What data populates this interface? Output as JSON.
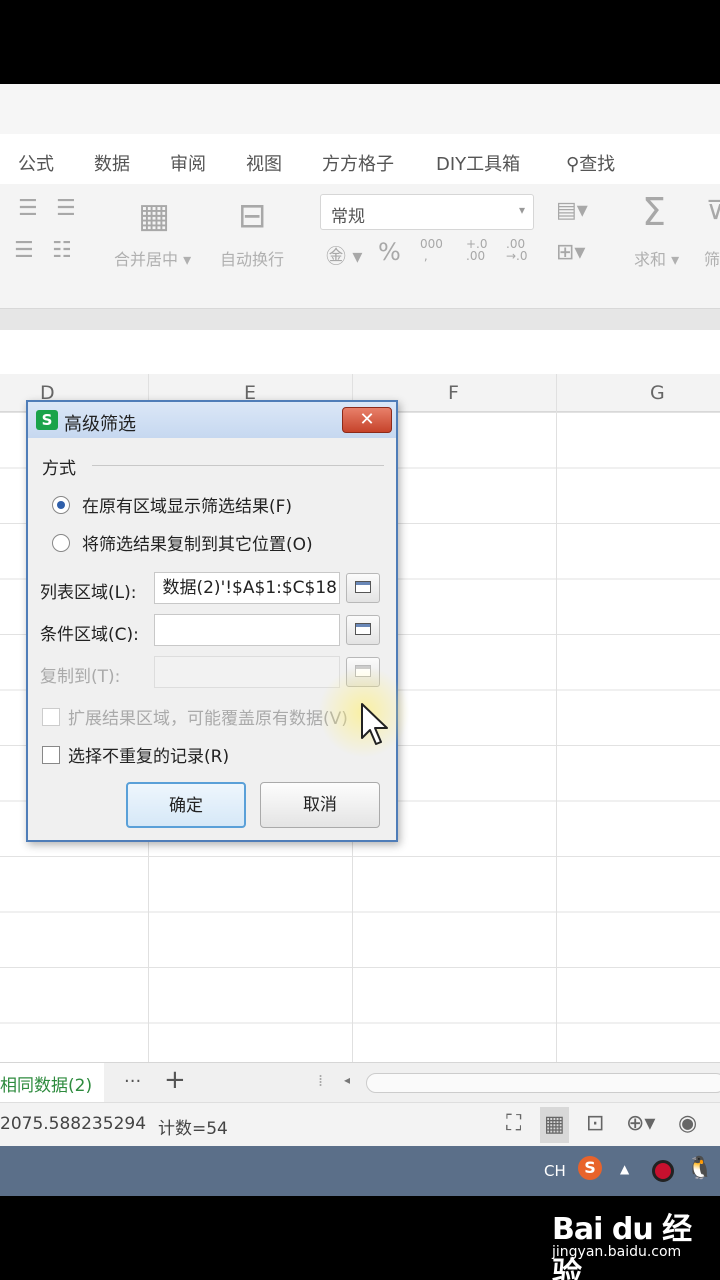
{
  "ribbon": {
    "tabs": [
      "公式",
      "数据",
      "审阅",
      "视图",
      "方方格子",
      "DIY工具箱",
      "查找"
    ],
    "merge_label": "合并居中",
    "wrap_label": "自动换行",
    "number_format": "常规",
    "percent_symbol": "%",
    "sum_label": "求和",
    "filter_partial": "筛"
  },
  "columns": [
    "D",
    "E",
    "F",
    "G"
  ],
  "dialog": {
    "title": "高级筛选",
    "close_symbol": "✕",
    "mode_group": "方式",
    "option_in_place": "在原有区域显示筛选结果(F)",
    "option_copy": "将筛选结果复制到其它位置(O)",
    "list_range_label": "列表区域(L):",
    "list_range_value": "数据(2)'!$A$1:$C$18",
    "criteria_label": "条件区域(C):",
    "criteria_value": "",
    "copy_to_label": "复制到(T):",
    "copy_to_value": "",
    "expand_label": "扩展结果区域，可能覆盖原有数据(V)",
    "unique_label": "选择不重复的记录(R)",
    "ok_label": "确定",
    "cancel_label": "取消"
  },
  "sheet_tabs": {
    "active": "相同数据(2)",
    "more": "···",
    "add": "+"
  },
  "status": {
    "average": "2075.588235294",
    "count": "计数=54"
  },
  "taskbar": {
    "lang": "CH"
  },
  "watermark": {
    "logo": "Bai du 经验",
    "sub": "jingyan.baidu.com"
  }
}
